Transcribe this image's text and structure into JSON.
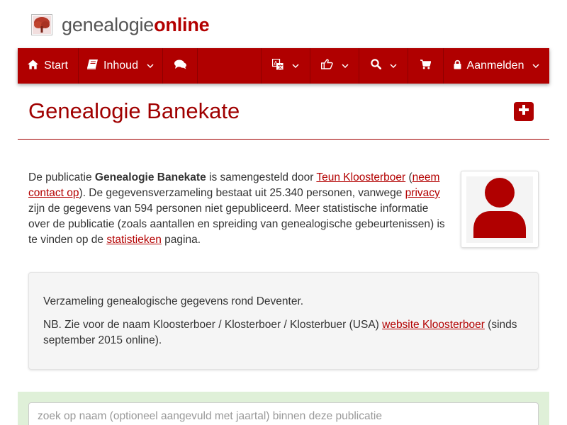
{
  "brand": {
    "part1": "genealogie",
    "part2": "online"
  },
  "nav": {
    "start_label": "Start",
    "inhoud_label": "Inhoud",
    "login_label": "Aanmelden"
  },
  "page": {
    "title": "Genealogie Banekate"
  },
  "intro": {
    "t1": "De publicatie ",
    "pub_name": "Genealogie Banekate",
    "t2": " is samengesteld door ",
    "author_link": "Teun Kloosterboer",
    "t3": " (",
    "contact_link": "neem contact op",
    "t4": "). De gegevensverzameling bestaat uit 25.340 personen, vanwege ",
    "privacy_link": "privacy",
    "t5": " zijn de gegevens van 594 personen niet gepubliceerd. Meer statistische informatie over de publicatie (zoals aantallen en spreiding van genealogische gebeurtenissen) is te vinden op de ",
    "stats_link": "statistieken",
    "t6": " pagina."
  },
  "info": {
    "line1": "Verzameling genealogische gegevens rond Deventer.",
    "line2_a": "NB. Zie voor de naam Kloosterboer / Klosterboer / Klosterbuer (USA) ",
    "website_link": "website Kloosterboer",
    "line2_b": " (sinds september 2015 online)."
  },
  "search": {
    "placeholder": "zoek op naam (optioneel aangevuld met jaartal) binnen deze publicatie"
  },
  "icons": {
    "logo": "tree-logo-icon",
    "start": "home-icon",
    "inhoud": "book-icon",
    "chat": "comments-icon",
    "lang": "translate-icon",
    "like": "thumbs-up-icon",
    "search": "search-icon",
    "cart": "cart-icon",
    "login": "lock-icon",
    "add": "plus-square-icon",
    "avatar": "user-icon"
  },
  "colors": {
    "brand_red": "#b00000",
    "title_red": "#a00000",
    "search_band": "#dff0d8",
    "info_bg": "#f5f5f5"
  }
}
